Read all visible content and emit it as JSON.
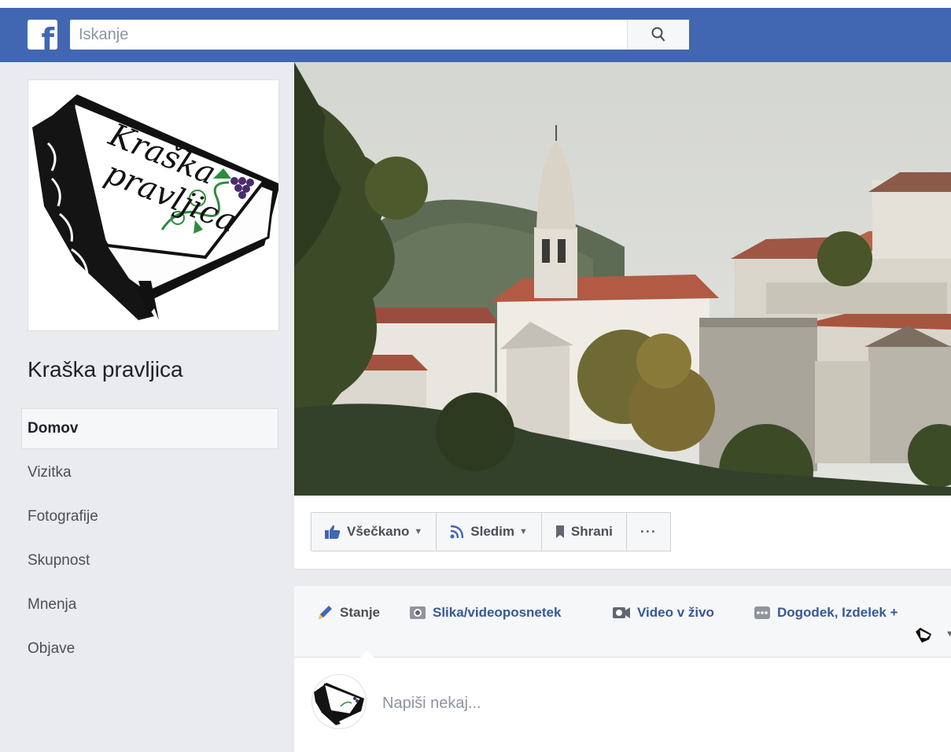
{
  "topbar": {
    "logo_letter": "f",
    "search_placeholder": "Iskanje"
  },
  "page": {
    "name": "Kraška pravljica",
    "logo_text_line1": "Kraška",
    "logo_text_line2": "pravljica"
  },
  "sidebar": {
    "items": [
      {
        "label": "Domov",
        "active": true
      },
      {
        "label": "Vizitka"
      },
      {
        "label": "Fotografije"
      },
      {
        "label": "Skupnost"
      },
      {
        "label": "Mnenja"
      },
      {
        "label": "Objave"
      }
    ]
  },
  "actions": {
    "like_label": "Všečkano",
    "follow_label": "Sledim",
    "save_label": "Shrani",
    "more_label": "···"
  },
  "composer": {
    "tab_status": "Stanje",
    "tab_photo": "Slika/videoposnetek",
    "tab_live": "Video v živo",
    "tab_event": "Dogodek, Izdelek +",
    "prompt": "Napiši nekaj..."
  },
  "colors": {
    "brand": "#4267b2",
    "background": "#e9ebee",
    "link": "#365899"
  }
}
